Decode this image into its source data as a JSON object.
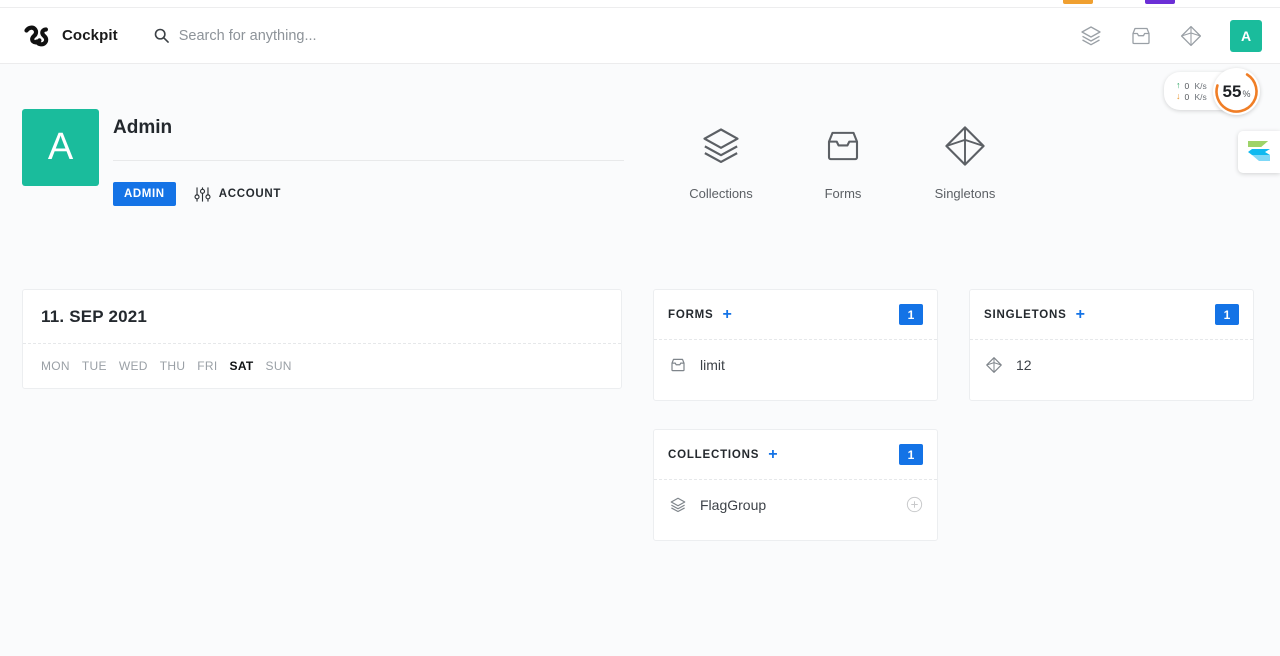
{
  "browser": {
    "tabmarks": [
      {
        "name": "orange-tab-indicator",
        "color": "#f0a030"
      },
      {
        "name": "purple-tab-indicator",
        "color": "#6b2fd6"
      }
    ]
  },
  "header": {
    "brand": "Cockpit",
    "logo_icon": "cockpit-logo-icon",
    "search": {
      "icon": "search-icon",
      "placeholder": "Search for anything...",
      "value": ""
    },
    "actions": [
      {
        "icon": "collections-layers-icon",
        "name": "header-collections-icon"
      },
      {
        "icon": "forms-inbox-icon",
        "name": "header-forms-icon"
      },
      {
        "icon": "singletons-diamond-icon",
        "name": "header-singletons-icon"
      }
    ],
    "avatar_letter": "A"
  },
  "profile": {
    "avatar_letter": "A",
    "name": "Admin",
    "role_badge": "ADMIN",
    "account_label": "ACCOUNT",
    "account_icon": "sliders-icon"
  },
  "nav_tiles": [
    {
      "label": "Collections",
      "icon": "collections-layers-icon"
    },
    {
      "label": "Forms",
      "icon": "forms-inbox-icon"
    },
    {
      "label": "Singletons",
      "icon": "singletons-diamond-icon"
    }
  ],
  "date_card": {
    "title": "11. SEP 2021",
    "weekdays": [
      {
        "label": "MON",
        "active": false
      },
      {
        "label": "TUE",
        "active": false
      },
      {
        "label": "WED",
        "active": false
      },
      {
        "label": "THU",
        "active": false
      },
      {
        "label": "FRI",
        "active": false
      },
      {
        "label": "SAT",
        "active": true
      },
      {
        "label": "SUN",
        "active": false
      }
    ]
  },
  "forms_card": {
    "title": "FORMS",
    "add_label": "+",
    "count": "1",
    "items": [
      {
        "label": "limit",
        "icon": "forms-inbox-icon"
      }
    ]
  },
  "singletons_card": {
    "title": "SINGLETONS",
    "add_label": "+",
    "count": "1",
    "items": [
      {
        "label": "12",
        "icon": "singletons-diamond-icon"
      }
    ]
  },
  "collections_card": {
    "title": "COLLECTIONS",
    "add_label": "+",
    "count": "1",
    "items": [
      {
        "label": "FlagGroup",
        "icon": "collections-layers-icon",
        "action_icon": "plus-circle-icon"
      }
    ]
  },
  "net_widget": {
    "upload": {
      "arrow": "↑",
      "value": "0",
      "unit": "K/s"
    },
    "download": {
      "arrow": "↓",
      "value": "0",
      "unit": "K/s"
    },
    "gauge_value": "55",
    "gauge_unit": "%",
    "gauge_color": "#f07e26"
  },
  "app_badge": {
    "name": "snipaste-logo-icon"
  },
  "colors": {
    "accent_blue": "#1473e6",
    "avatar_green": "#1abc9c",
    "page_bg": "#fafbfc",
    "card_bg": "#ffffff"
  }
}
